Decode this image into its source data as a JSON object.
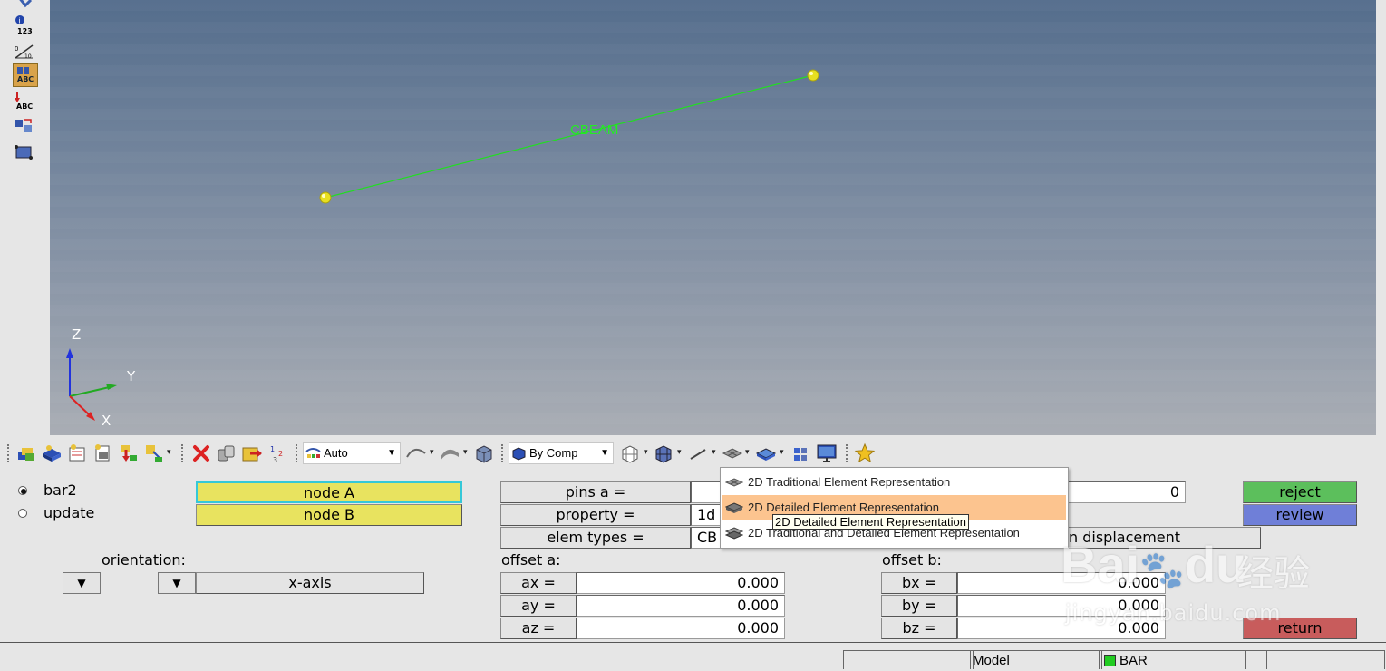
{
  "viewport": {
    "element_label": "CBEAM",
    "axes": {
      "z": "Z",
      "y": "Y",
      "x": "X"
    }
  },
  "left_toolbar": {
    "icons": [
      "connector-icon",
      "info-icon",
      "numbers-icon",
      "measure-icon",
      "label-abc-icon",
      "label-move-icon",
      "transform-icon",
      "plane-icon"
    ],
    "numbers_text": "123",
    "abc_text": "ABC",
    "abc2_text": "ABC"
  },
  "toolbar": {
    "shading_combo": "Auto",
    "color_combo": "By Comp"
  },
  "panel": {
    "radios": [
      {
        "label": "bar2",
        "selected": true
      },
      {
        "label": "update",
        "selected": false
      }
    ],
    "node_a": "node A",
    "node_b": "node B",
    "orientation_label": "orientation:",
    "x_axis": "x-axis",
    "pins_a_label": "pins  a =",
    "property_label": "property =",
    "property_value": "1d",
    "elem_types_label": "elem types =",
    "elem_types_value": "CB",
    "pins_b_value": "0",
    "displacement_label": "n displacement",
    "offset_a_label": "offset a:",
    "offset_b_label": "offset b:",
    "offsets_a": [
      {
        "label": "ax =",
        "value": "0.000"
      },
      {
        "label": "ay =",
        "value": "0.000"
      },
      {
        "label": "az =",
        "value": "0.000"
      }
    ],
    "offsets_b": [
      {
        "label": "bx =",
        "value": "0.000"
      },
      {
        "label": "by =",
        "value": "0.000"
      },
      {
        "label": "bz =",
        "value": "0.000"
      }
    ],
    "reject": "reject",
    "review": "review",
    "return": "return",
    "colors": {
      "reject": "#5cbf5c",
      "review": "#6f7fd8",
      "return": "#c85c5c",
      "node_field": "#e8e35f"
    }
  },
  "menu": {
    "items": [
      {
        "label": "2D Traditional Element Representation",
        "highlighted": false
      },
      {
        "label": "2D Detailed Element Representation",
        "highlighted": true
      },
      {
        "label": "2D Traditional and Detailed Element Representation",
        "highlighted": false
      }
    ],
    "tooltip": "2D Detailed Element Representation",
    "highlight_color": "#fcc48f"
  },
  "status_bar": {
    "model": "Model",
    "component": "BAR",
    "component_color": "#22cc22"
  },
  "watermark": {
    "brand": "Bai",
    "brand2": "du",
    "cn": "经验",
    "url": "jingyan.baidu.com"
  }
}
